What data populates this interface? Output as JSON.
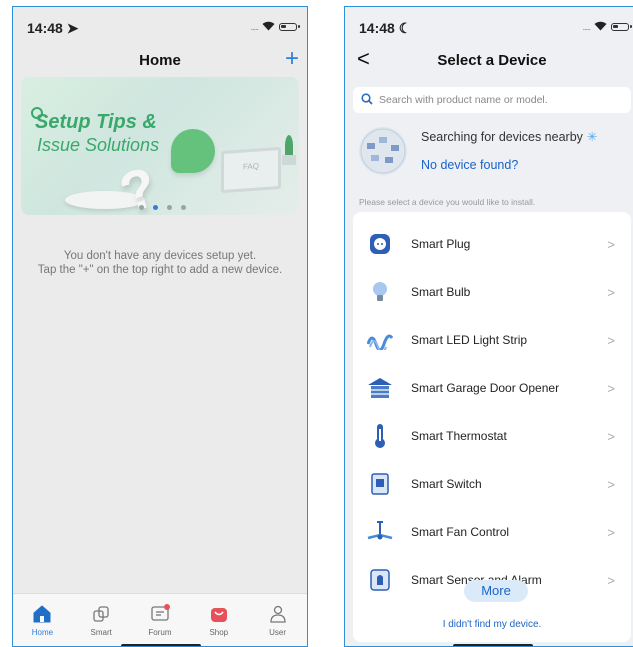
{
  "left_screen": {
    "status": {
      "time": "14:48",
      "time_icon": "location-arrow-icon",
      "signal": "....."
    },
    "header": {
      "title": "Home",
      "add_icon": "+"
    },
    "banner": {
      "line1": "Setup Tips &",
      "line2": "Issue Solutions",
      "monitor_text": "FAQ",
      "page_count": 4,
      "active_page": 1
    },
    "empty_state": {
      "line1": "You don't have any devices setup yet.",
      "line2": "Tap the \"+\" on the top right to add a new device."
    },
    "tabs": [
      {
        "label": "Home",
        "icon": "home-icon",
        "active": true
      },
      {
        "label": "Smart",
        "icon": "cubes-icon",
        "active": false
      },
      {
        "label": "Forum",
        "icon": "forum-icon",
        "active": false,
        "badge": true
      },
      {
        "label": "Shop",
        "icon": "shop-bag-icon",
        "active": false
      },
      {
        "label": "User",
        "icon": "user-icon",
        "active": false
      }
    ]
  },
  "right_screen": {
    "status": {
      "time": "14:48",
      "time_icon": "moon-icon",
      "signal": "....."
    },
    "header": {
      "title": "Select a Device",
      "back_icon": "<"
    },
    "search": {
      "placeholder": "Search with product name or model.",
      "value": ""
    },
    "scan": {
      "searching_text": "Searching for devices nearby",
      "no_device_text": "No device found?"
    },
    "hint": "Please select a device you would like to install.",
    "devices": [
      {
        "label": "Smart Plug",
        "icon": "plug-icon"
      },
      {
        "label": "Smart Bulb",
        "icon": "bulb-icon"
      },
      {
        "label": "Smart LED Light Strip",
        "icon": "led-strip-icon"
      },
      {
        "label": "Smart Garage Door Opener",
        "icon": "garage-icon"
      },
      {
        "label": "Smart Thermostat",
        "icon": "thermometer-icon"
      },
      {
        "label": "Smart Switch",
        "icon": "switch-icon"
      },
      {
        "label": "Smart Fan Control",
        "icon": "fan-icon"
      },
      {
        "label": "Smart Sensor and Alarm",
        "icon": "sensor-icon"
      }
    ],
    "chevron": ">",
    "more_label": "More",
    "not_found_link": "I didn't find my device."
  },
  "colors": {
    "accent": "#2d7fd7",
    "link": "#1c63c7",
    "banner_green": "#3aa86b",
    "shop_red": "#e8515a"
  }
}
